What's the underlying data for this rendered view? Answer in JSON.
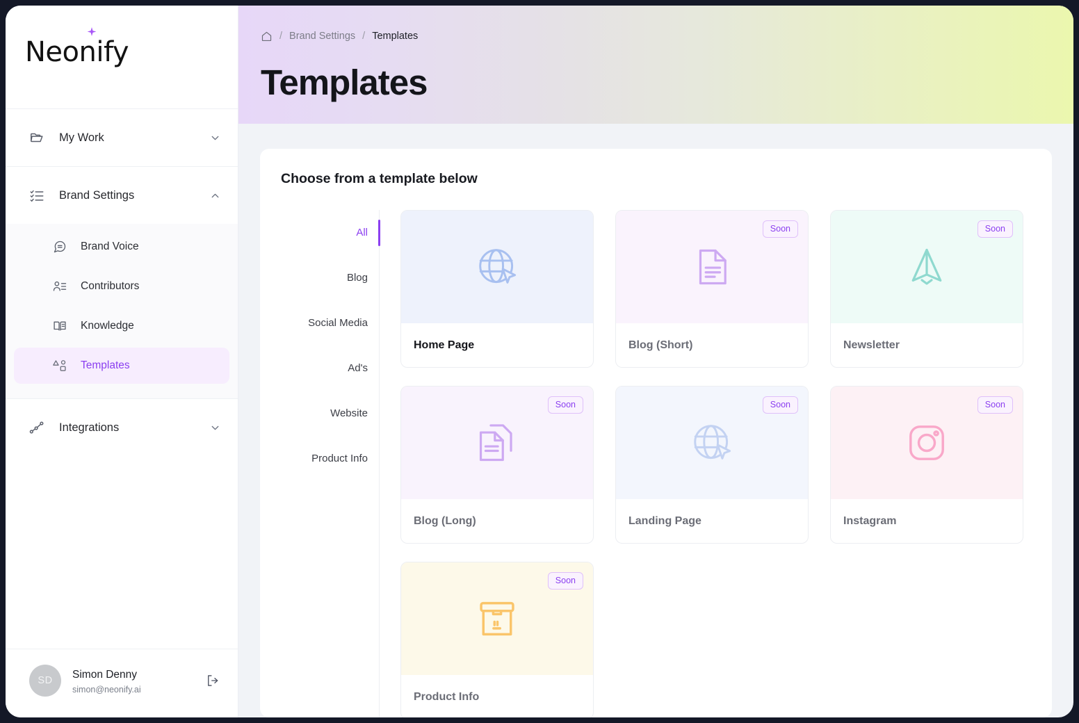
{
  "brand": {
    "name": "Neonify",
    "spark_icon": "sparkle-icon"
  },
  "sidebar": {
    "groups": [
      {
        "label": "My Work",
        "icon": "folder-icon",
        "chevron": "chevron-down-icon",
        "expanded": false,
        "items": []
      },
      {
        "label": "Brand Settings",
        "icon": "checklist-icon",
        "chevron": "chevron-up-icon",
        "expanded": true,
        "items": [
          {
            "label": "Brand Voice",
            "icon": "message-icon",
            "active": false
          },
          {
            "label": "Contributors",
            "icon": "user-list-icon",
            "active": false
          },
          {
            "label": "Knowledge",
            "icon": "book-icon",
            "active": false
          },
          {
            "label": "Templates",
            "icon": "templates-icon",
            "active": true
          }
        ]
      },
      {
        "label": "Integrations",
        "icon": "network-icon",
        "chevron": "chevron-down-icon",
        "expanded": false,
        "items": []
      }
    ],
    "profile": {
      "initials": "SD",
      "name": "Simon Denny",
      "email": "simon@neonify.ai",
      "logout_icon": "logout-icon"
    }
  },
  "header": {
    "breadcrumb": {
      "home_icon": "home-icon",
      "separator": "/",
      "items": [
        "Brand Settings",
        "Templates"
      ]
    },
    "title": "Templates",
    "gradient_from": "#e7d7f8",
    "gradient_to": "#ebf7ae"
  },
  "panel": {
    "title": "Choose from a template below",
    "categories": [
      {
        "label": "All",
        "active": true
      },
      {
        "label": "Blog",
        "active": false
      },
      {
        "label": "Social Media",
        "active": false
      },
      {
        "label": "Ad's",
        "active": false
      },
      {
        "label": "Website",
        "active": false
      },
      {
        "label": "Product Info",
        "active": false
      }
    ],
    "badge_label": "Soon",
    "templates": [
      {
        "name": "Home Page",
        "icon": "globe-cursor-icon",
        "soon": false,
        "thumb_bg": "#eef2fc",
        "icon_color": "#a8c0f0"
      },
      {
        "name": "Blog (Short)",
        "icon": "document-icon",
        "soon": true,
        "thumb_bg": "#faf3fd",
        "icon_color": "#cda9f2"
      },
      {
        "name": "Newsletter",
        "icon": "paper-plane-icon",
        "soon": true,
        "thumb_bg": "#eefbf7",
        "icon_color": "#8fd9cf"
      },
      {
        "name": "Blog (Long)",
        "icon": "documents-stack-icon",
        "soon": true,
        "thumb_bg": "#f9f3fd",
        "icon_color": "#cda9f2"
      },
      {
        "name": "Landing Page",
        "icon": "globe-cursor-icon",
        "soon": true,
        "thumb_bg": "#f3f6fd",
        "icon_color": "#c3d2f2"
      },
      {
        "name": "Instagram",
        "icon": "instagram-icon",
        "soon": true,
        "thumb_bg": "#fdf1f5",
        "icon_color": "#f9a8c9"
      },
      {
        "name": "Product Info",
        "icon": "box-icon",
        "soon": true,
        "thumb_bg": "#fdf9e9",
        "icon_color": "#fac56a"
      }
    ]
  },
  "colors": {
    "accent": "#8b3ff0",
    "frame": "#141827",
    "canvas": "#f1f3f7"
  }
}
